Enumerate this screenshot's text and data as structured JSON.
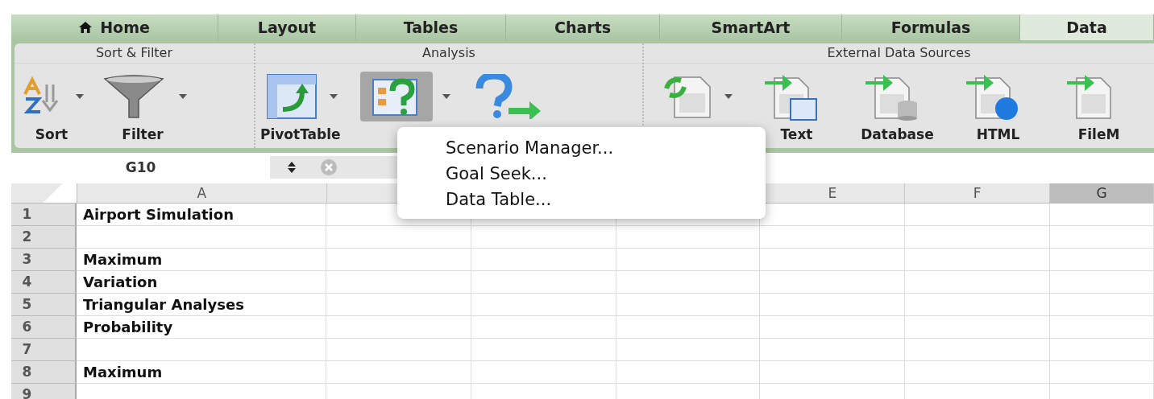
{
  "tabs": [
    {
      "label": "Home",
      "selected": false
    },
    {
      "label": "Layout",
      "selected": false
    },
    {
      "label": "Tables",
      "selected": false
    },
    {
      "label": "Charts",
      "selected": false
    },
    {
      "label": "SmartArt",
      "selected": false
    },
    {
      "label": "Formulas",
      "selected": false
    },
    {
      "label": "Data",
      "selected": true
    }
  ],
  "ribbon": [
    {
      "title": "Sort & Filter",
      "buttons": [
        {
          "kind": "sort",
          "label": "Sort",
          "dropdown": true,
          "pressed": false
        },
        {
          "kind": "filter",
          "label": "Filter",
          "dropdown": true,
          "pressed": false
        }
      ]
    },
    {
      "title": "Analysis",
      "buttons": [
        {
          "kind": "pivot",
          "label": "PivotTable",
          "dropdown": true,
          "pressed": false
        },
        {
          "kind": "whatif",
          "dropdown": true,
          "pressed": true
        },
        {
          "kind": "solver",
          "dropdown": false,
          "pressed": false
        }
      ]
    },
    {
      "title": "External Data Sources",
      "buttons": [
        {
          "kind": "refresh",
          "dropdown": true,
          "pressed": false
        },
        {
          "kind": "text",
          "label": "Text",
          "dropdown": false,
          "pressed": false
        },
        {
          "kind": "database",
          "label": "Database",
          "dropdown": false,
          "pressed": false
        },
        {
          "kind": "html",
          "label": "HTML",
          "dropdown": false,
          "pressed": false
        },
        {
          "kind": "filemaker",
          "label": "FileM",
          "dropdown": false,
          "pressed": false
        }
      ]
    }
  ],
  "name_box": {
    "value": "G10"
  },
  "columns": [
    {
      "label": "A",
      "selected": false
    },
    {
      "selected": false
    },
    {},
    {},
    {
      "label": "E",
      "selected": false
    },
    {
      "label": "F",
      "selected": false
    },
    {
      "label": "G",
      "selected": true
    }
  ],
  "rows": [
    {
      "number": "1",
      "cell_a": "Airport Simulation"
    },
    {
      "number": "2"
    },
    {
      "number": "3",
      "cell_a": "Maximum"
    },
    {
      "number": "4",
      "cell_a": "Variation"
    },
    {
      "number": "5",
      "cell_a": "Triangular Analyses"
    },
    {
      "number": "6",
      "cell_a": "Probability"
    },
    {
      "number": "7"
    },
    {
      "number": "8",
      "cell_a": "Maximum"
    },
    {
      "number": "9"
    }
  ],
  "menu": {
    "items": [
      "Scenario Manager...",
      "Goal Seek...",
      "Data Table..."
    ]
  }
}
